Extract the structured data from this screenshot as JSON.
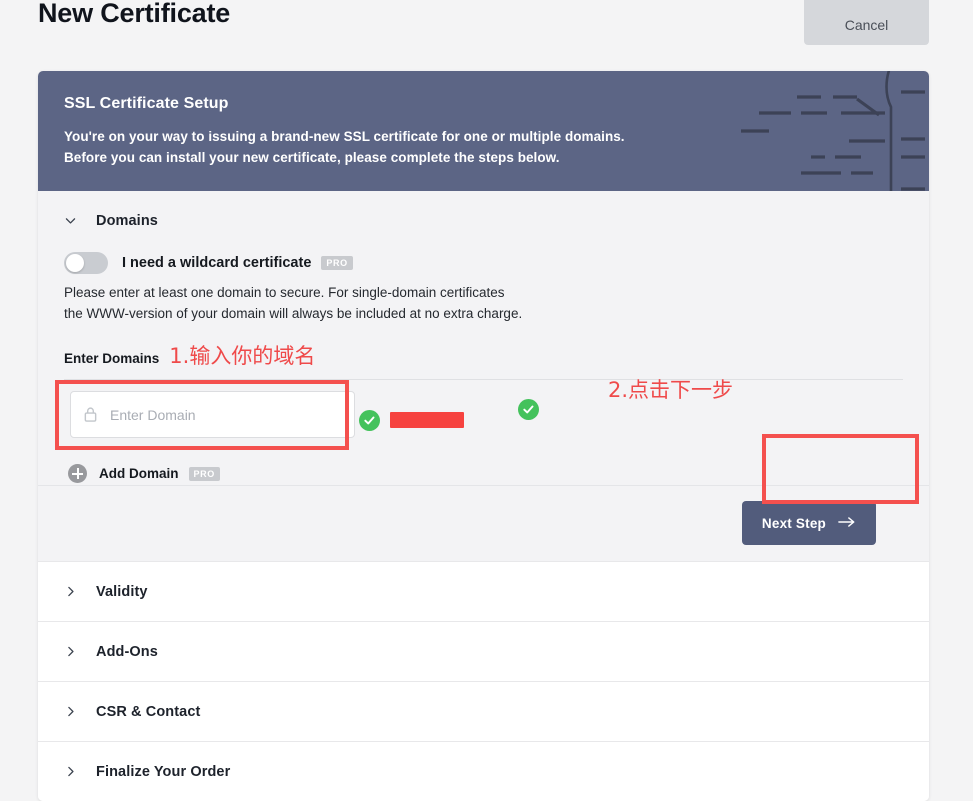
{
  "header": {
    "title": "New Certificate",
    "cancel_label": "Cancel"
  },
  "banner": {
    "title": "SSL Certificate Setup",
    "line1": "You're on your way to issuing a brand-new SSL certificate for one or multiple domains.",
    "line2": "Before you can install your new certificate, please complete the steps below."
  },
  "domains": {
    "section_title": "Domains",
    "wildcard_toggle_label": "I need a wildcard certificate",
    "wildcard_toggle_state": "off",
    "pro_badge": "PRO",
    "help_line1": "Please enter at least one domain to secure. For single-domain certificates",
    "help_line2": "the WWW-version of your domain will always be included at no extra charge.",
    "enter_domains_label": "Enter Domains",
    "domain_input_value": "",
    "domain_input_placeholder": "Enter Domain",
    "add_domain_label": "Add Domain",
    "add_domain_pro_badge": "PRO",
    "next_step_label": "Next Step"
  },
  "sections": [
    {
      "title": "Validity",
      "state": "collapsed"
    },
    {
      "title": "Add-Ons",
      "state": "collapsed"
    },
    {
      "title": "CSR & Contact",
      "state": "collapsed"
    },
    {
      "title": "Finalize Your Order",
      "state": "collapsed"
    }
  ],
  "annotations": {
    "step1_text": "1.输入你的域名",
    "step2_text": "2.点击下一步"
  },
  "colors": {
    "page_background": "#f4f4f5",
    "banner_background": "#5c6585",
    "primary_button": "#525c7c",
    "annotation_red": "#f4504e",
    "success_green": "#44c25c",
    "redaction_red": "#f6423f",
    "pro_badge_gray": "#c8cace"
  }
}
